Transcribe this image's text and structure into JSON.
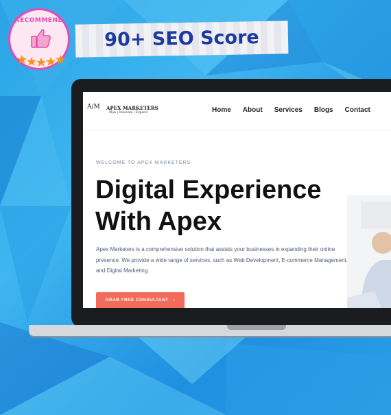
{
  "badge": {
    "text": "RECOMMEND",
    "icon": "thumbs-up-icon",
    "stars": 5
  },
  "tape": {
    "text": "90+ SEO Score"
  },
  "website": {
    "logo": {
      "mark": "A/M",
      "name": "APEX MARKETERS",
      "tagline": "Plan | Innovate | Expand"
    },
    "nav": [
      "Home",
      "About",
      "Services",
      "Blogs",
      "Contact"
    ],
    "hero": {
      "eyebrow": "WELCOME TO APEX MARKETERS",
      "title_line1": "Digital Experience",
      "title_line2": "With Apex",
      "description": "Apex Marketers is a comprehensive solution that assists your businesses in expanding their online presence. We provide a wide range of services, such as Web Development, E-commerce Management, and Digital Marketing.",
      "cta_label": "GRAB FREE CONSULTANT",
      "cta_arrow": "›"
    }
  },
  "colors": {
    "accent": "#f26b5b",
    "badge_pink": "#e24bb4",
    "tape_text": "#1c3aa0",
    "bg_blue": "#2aa3e6"
  }
}
